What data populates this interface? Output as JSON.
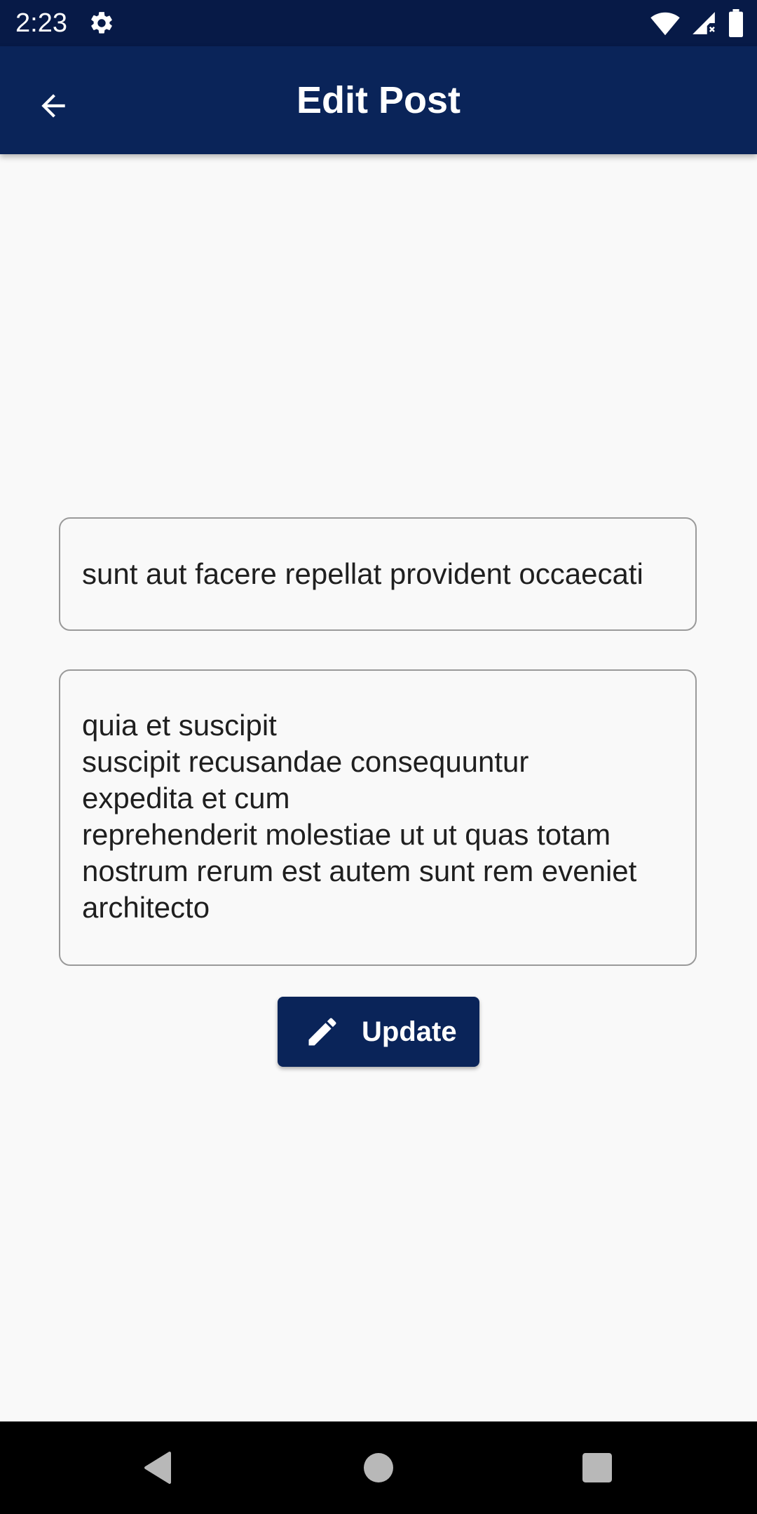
{
  "status_bar": {
    "time": "2:23",
    "icons": [
      "settings-gear-icon",
      "wifi-icon",
      "cell-signal-icon",
      "battery-icon"
    ]
  },
  "app_bar": {
    "title": "Edit Post",
    "back_icon": "arrow-back-icon"
  },
  "form": {
    "title_value": "sunt aut facere repellat provident occaecati",
    "body_value": "quia et suscipit\nsuscipit recusandae consequuntur\nexpedita et cum\nreprehenderit molestiae ut ut quas totam\nnostrum rerum est autem sunt rem eveniet\narchitecto",
    "update_label": "Update",
    "update_icon": "pencil-edit-icon"
  },
  "nav_bar": {
    "icons": [
      "nav-back-icon",
      "nav-home-icon",
      "nav-recents-icon"
    ]
  },
  "colors": {
    "status_bar": "#071a47",
    "app_bar": "#0a2459",
    "background": "#f9f9f9",
    "accent": "#0a2459",
    "field_border": "#9a9a9a"
  }
}
